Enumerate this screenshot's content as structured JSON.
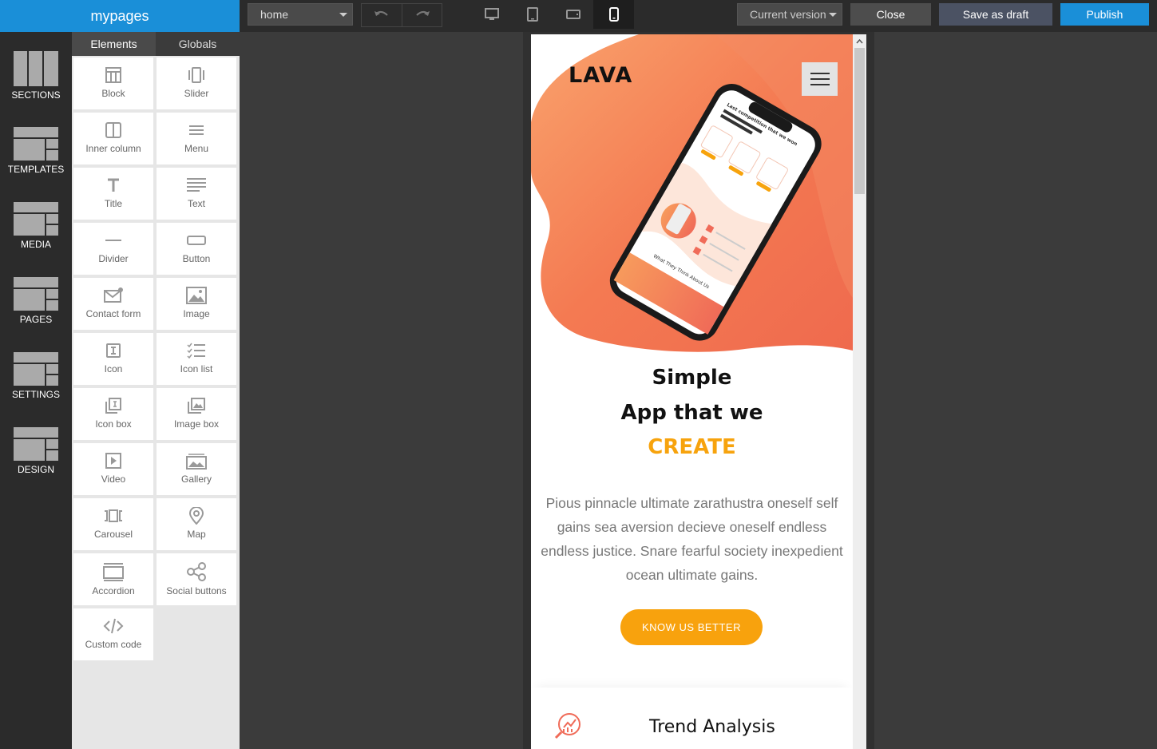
{
  "app": {
    "brand": "mypages"
  },
  "toolbar": {
    "page_select": "home",
    "version_select": "Current version",
    "close_label": "Close",
    "draft_label": "Save as draft",
    "publish_label": "Publish"
  },
  "leftnav": {
    "items": [
      {
        "label": "SECTIONS",
        "icon": "sections-icon"
      },
      {
        "label": "TEMPLATES",
        "icon": "templates-icon"
      },
      {
        "label": "MEDIA",
        "icon": "media-icon"
      },
      {
        "label": "PAGES",
        "icon": "pages-icon"
      },
      {
        "label": "SETTINGS",
        "icon": "settings-icon"
      },
      {
        "label": "DESIGN",
        "icon": "design-icon"
      }
    ]
  },
  "panel": {
    "tabs": [
      "Elements",
      "Globals"
    ],
    "elements": [
      {
        "label": "Block",
        "icon": "block-icon"
      },
      {
        "label": "Slider",
        "icon": "slider-icon"
      },
      {
        "label": "Inner column",
        "icon": "inner-column-icon"
      },
      {
        "label": "Menu",
        "icon": "menu-icon"
      },
      {
        "label": "Title",
        "icon": "title-icon"
      },
      {
        "label": "Text",
        "icon": "text-icon"
      },
      {
        "label": "Divider",
        "icon": "divider-icon"
      },
      {
        "label": "Button",
        "icon": "button-icon"
      },
      {
        "label": "Contact form",
        "icon": "contact-form-icon"
      },
      {
        "label": "Image",
        "icon": "image-icon"
      },
      {
        "label": "Icon",
        "icon": "icon-icon"
      },
      {
        "label": "Icon list",
        "icon": "icon-list-icon"
      },
      {
        "label": "Icon box",
        "icon": "icon-box-icon"
      },
      {
        "label": "Image box",
        "icon": "image-box-icon"
      },
      {
        "label": "Video",
        "icon": "video-icon"
      },
      {
        "label": "Gallery",
        "icon": "gallery-icon"
      },
      {
        "label": "Carousel",
        "icon": "carousel-icon"
      },
      {
        "label": "Map",
        "icon": "map-pin-icon"
      },
      {
        "label": "Accordion",
        "icon": "accordion-icon"
      },
      {
        "label": "Social buttons",
        "icon": "share-icon"
      },
      {
        "label": "Custom code",
        "icon": "code-icon"
      }
    ]
  },
  "preview": {
    "logo": "LAVA",
    "heading_line1": "Simple",
    "heading_line2": "App that we",
    "heading_line3": "CREATE",
    "paragraph": "Pious pinnacle ultimate zarathustra oneself self gains sea aversion decieve oneself endless endless justice. Snare fearful society inexpedient ocean ultimate gains.",
    "cta": "KNOW US BETTER",
    "feature_title": "Trend Analysis",
    "phone_screen_heading": "Last competition that we won",
    "phone_screen_caption": "What They Think About Us",
    "colors": {
      "accent": "#f8a20d",
      "brand_blue": "#1a8fd8",
      "hero_orange": "#f27b4f"
    }
  }
}
